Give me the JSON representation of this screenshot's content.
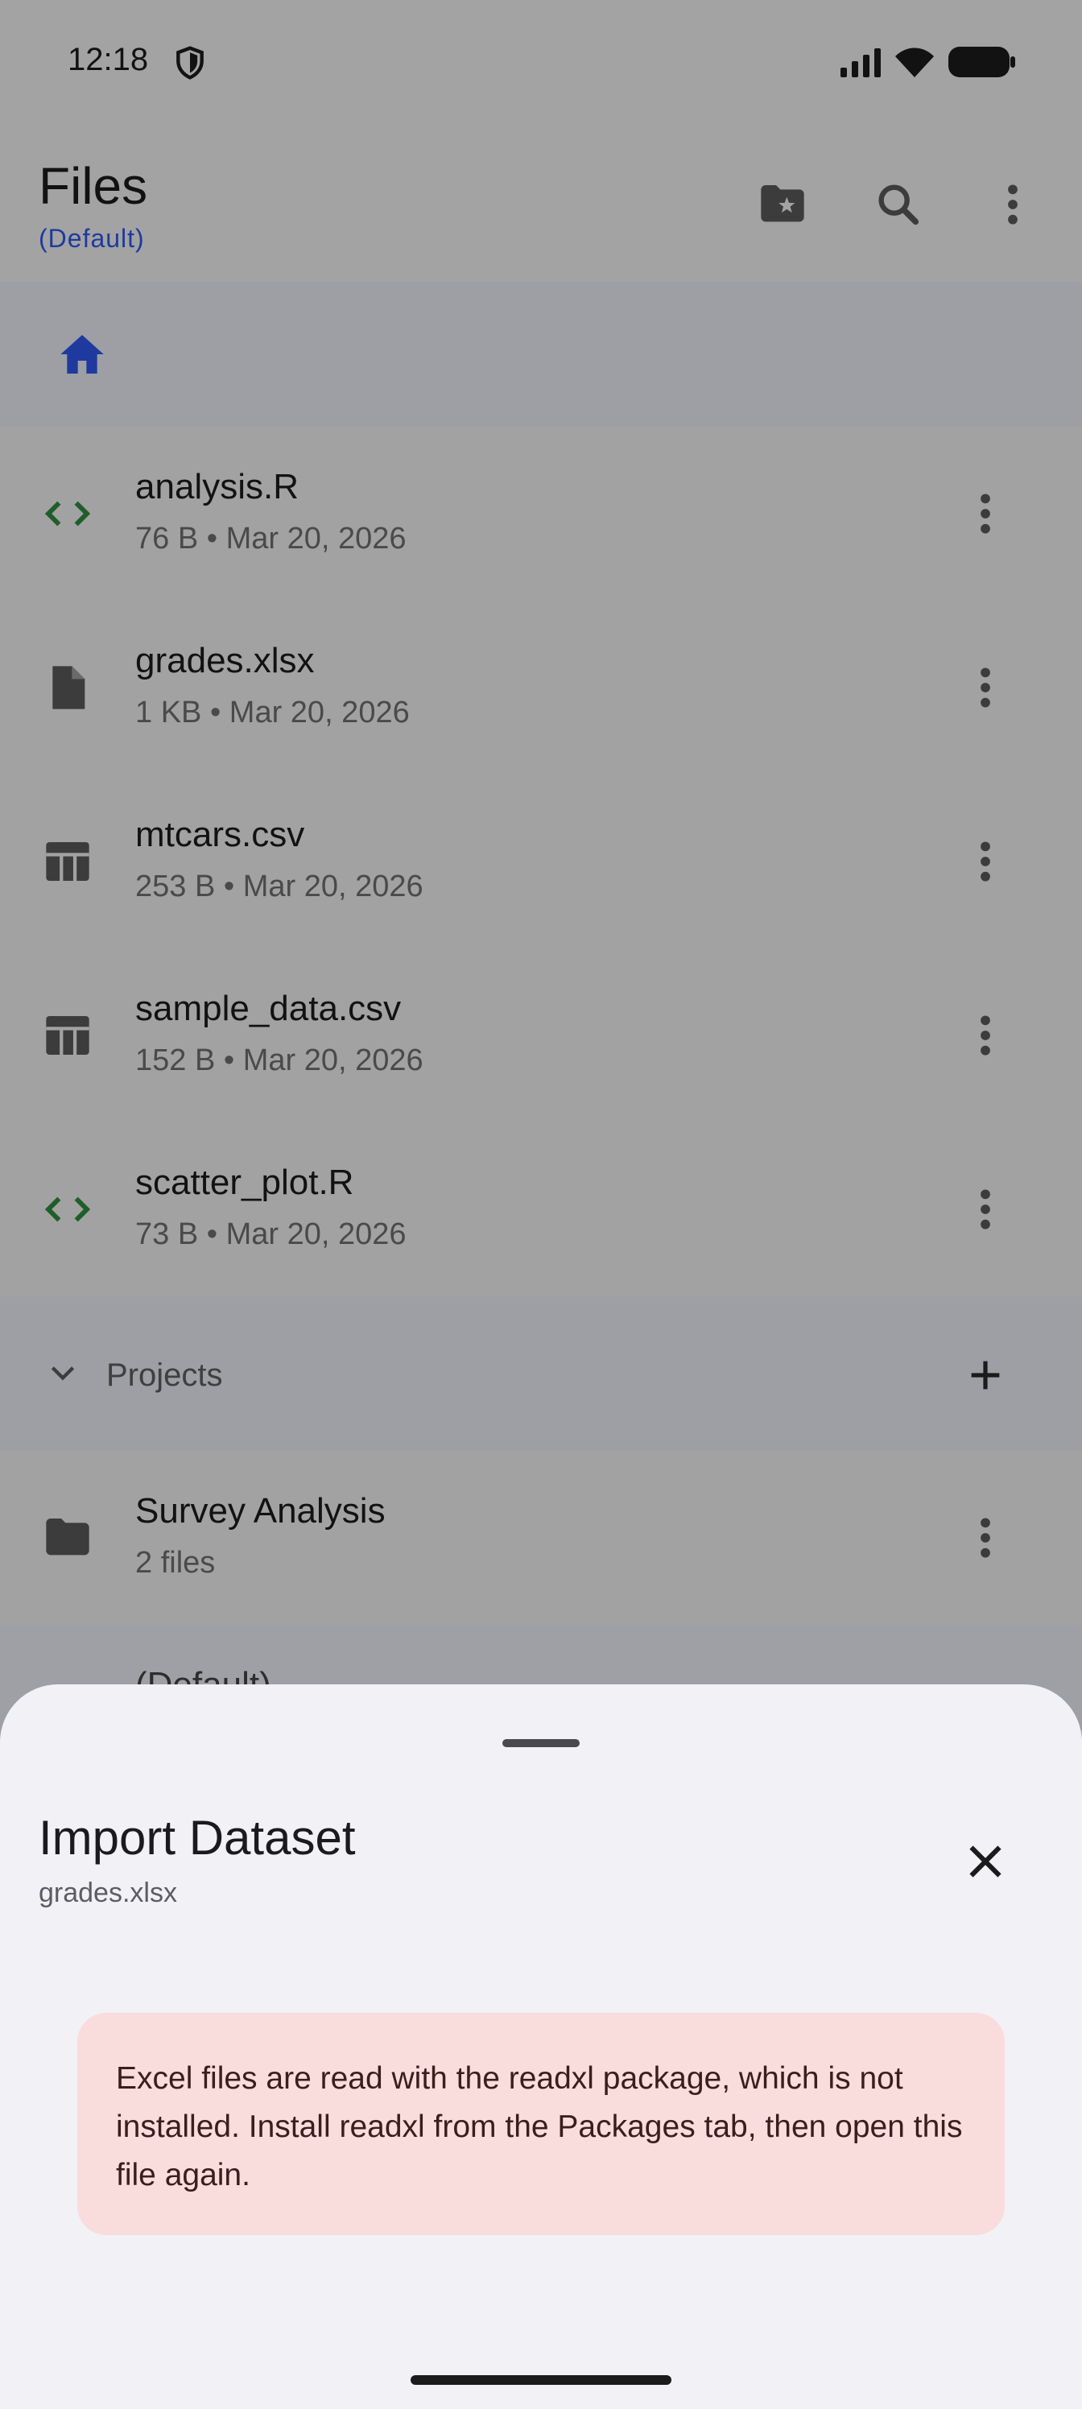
{
  "status_bar": {
    "time": "12:18"
  },
  "app_bar": {
    "title": "Files",
    "subtitle": "(Default)",
    "actions": [
      "starred-folder-icon",
      "search-icon",
      "more-vert-icon"
    ]
  },
  "files": [
    {
      "name": "analysis.R",
      "meta": "76 B • Mar 20, 2026",
      "icon": "code-icon"
    },
    {
      "name": "grades.xlsx",
      "meta": "1 KB • Mar 20, 2026",
      "icon": "file-icon"
    },
    {
      "name": "mtcars.csv",
      "meta": "253 B • Mar 20, 2026",
      "icon": "table-icon"
    },
    {
      "name": "sample_data.csv",
      "meta": "152 B • Mar 20, 2026",
      "icon": "table-icon"
    },
    {
      "name": "scatter_plot.R",
      "meta": "73 B • Mar 20, 2026",
      "icon": "code-icon"
    }
  ],
  "projects": {
    "label": "Projects",
    "items": [
      {
        "name": "Survey Analysis",
        "meta": "2 files"
      }
    ],
    "peek_item": "(Default)"
  },
  "sheet": {
    "title": "Import Dataset",
    "subtitle": "grades.xlsx",
    "error": "Excel files are read with the readxl package, which is not installed. Install readxl from the Packages tab, then open this file again."
  },
  "colors": {
    "accent_blue": "#1e3a9e",
    "code_green": "#1f5e2a",
    "error_bg": "#f9dcdc",
    "sheet_bg": "#f2f1f6"
  }
}
